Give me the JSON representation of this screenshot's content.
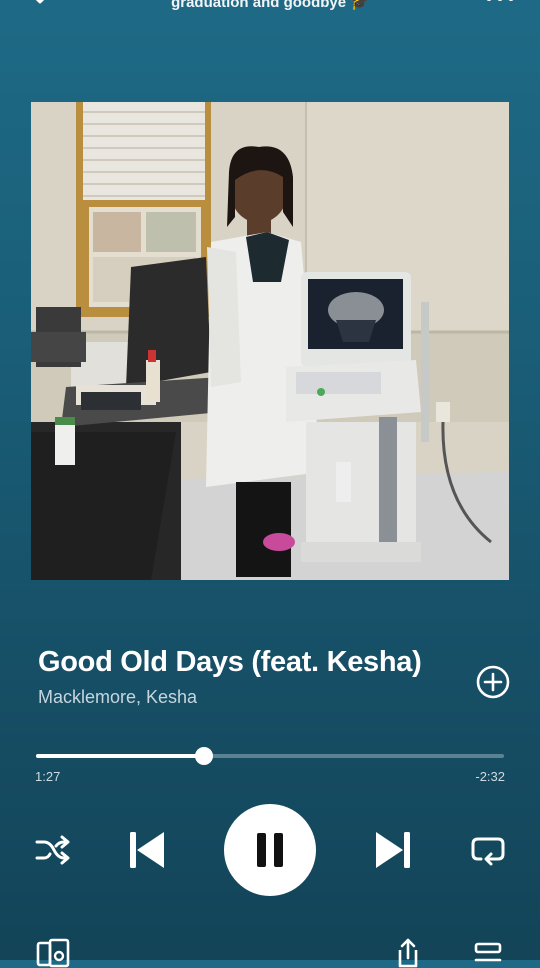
{
  "header": {
    "playlist_title": "graduation and goodbye 🎓",
    "collapse_icon": "chevron-down-icon",
    "more_icon": "more-options-icon"
  },
  "track": {
    "title": "Good Old Days (feat. Kesha)",
    "artists": "Macklemore, Kesha",
    "add_icon": "add-circle-icon"
  },
  "playback": {
    "elapsed": "1:27",
    "remaining": "-2:32",
    "progress_fraction": 0.36,
    "is_playing": true
  },
  "controls": {
    "shuffle_icon": "shuffle-icon",
    "previous_icon": "skip-previous-icon",
    "pause_icon": "pause-icon",
    "next_icon": "skip-next-icon",
    "repeat_icon": "repeat-icon"
  },
  "footer": {
    "devices_icon": "connect-devices-icon",
    "share_icon": "share-icon",
    "queue_icon": "queue-icon"
  },
  "colors": {
    "background_top": "#1e6a86",
    "background_bottom": "#134458",
    "accent": "#ffffff"
  }
}
